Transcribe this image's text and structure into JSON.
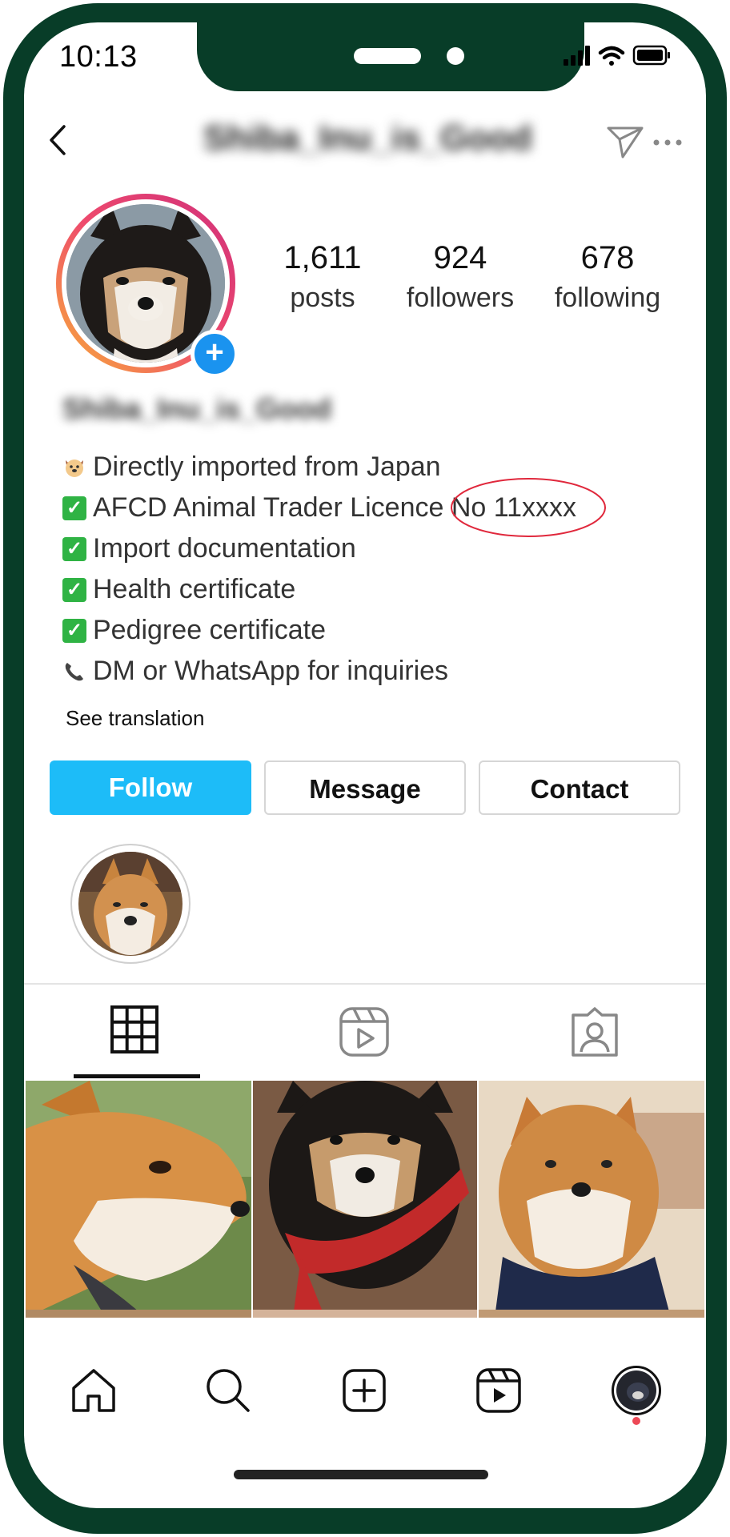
{
  "status_bar": {
    "time": "10:13"
  },
  "header": {
    "username": "Shiba_Inu_is_Good"
  },
  "profile": {
    "name": "Shiba_Inu_is_Good",
    "stats": [
      {
        "value": "1,611",
        "label": "posts"
      },
      {
        "value": "924",
        "label": "followers"
      },
      {
        "value": "678",
        "label": "following"
      }
    ],
    "bio": [
      {
        "icon": "dog-emoji",
        "text": "Directly imported from Japan"
      },
      {
        "icon": "check-mark-emoji",
        "text": "AFCD Animal Trader Licence No 11xxxx"
      },
      {
        "icon": "check-mark-emoji",
        "text": "Import documentation"
      },
      {
        "icon": "check-mark-emoji",
        "text": "Health certificate"
      },
      {
        "icon": "check-mark-emoji",
        "text": "Pedigree certificate"
      },
      {
        "icon": "phone-emoji",
        "text": "DM or WhatsApp for inquiries"
      }
    ],
    "see_translation": "See translation"
  },
  "actions": {
    "follow": "Follow",
    "message": "Message",
    "contact": "Contact"
  },
  "tabs": [
    "grid-icon",
    "reels-icon",
    "tagged-icon"
  ],
  "bottom_nav": [
    "home-icon",
    "search-icon",
    "create-icon",
    "reels-icon",
    "profile-avatar"
  ],
  "colors": {
    "frame": "#083d28",
    "follow_button": "#1dbcf8",
    "add_story": "#1a93ef",
    "annotation": "#e0283c"
  }
}
